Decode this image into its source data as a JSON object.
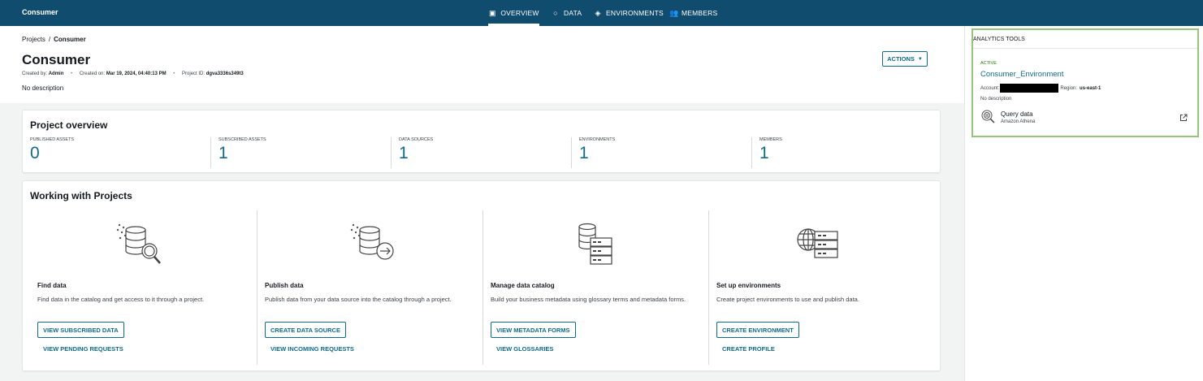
{
  "topbar": {
    "project_name": "Consumer",
    "tabs": [
      {
        "label": "OVERVIEW",
        "icon": "overview-icon",
        "active": true
      },
      {
        "label": "DATA",
        "icon": "data-circle-icon",
        "active": false
      },
      {
        "label": "ENVIRONMENTS",
        "icon": "layers-icon",
        "active": false
      },
      {
        "label": "MEMBERS",
        "icon": "members-icon",
        "active": false
      }
    ]
  },
  "header": {
    "breadcrumb": [
      "Projects",
      "Consumer"
    ],
    "breadcrumb_sep": "/",
    "title": "Consumer",
    "created_by_label": "Created by:",
    "created_by": "Admin",
    "created_on_label": "Created on:",
    "created_on": "Mar 19, 2024, 04:40:13 PM",
    "project_id_label": "Project ID:",
    "project_id": "dgva3336s349t3",
    "description": "No description",
    "actions_label": "ACTIONS"
  },
  "overview": {
    "title": "Project overview",
    "stats": [
      {
        "label": "PUBLISHED ASSETS",
        "value": "0"
      },
      {
        "label": "SUBSCRIBED ASSETS",
        "value": "1"
      },
      {
        "label": "DATA SOURCES",
        "value": "1"
      },
      {
        "label": "ENVIRONMENTS",
        "value": "1"
      },
      {
        "label": "MEMBERS",
        "value": "1"
      }
    ]
  },
  "working": {
    "title": "Working with Projects",
    "columns": [
      {
        "title": "Find data",
        "description": "Find data in the catalog and get access to it through a project.",
        "button": "VIEW SUBSCRIBED DATA",
        "link": "VIEW PENDING REQUESTS",
        "icon": "find-data-icon"
      },
      {
        "title": "Publish data",
        "description": "Publish data from your data source into the catalog through a project.",
        "button": "CREATE DATA SOURCE",
        "link": "VIEW INCOMING REQUESTS",
        "icon": "publish-data-icon"
      },
      {
        "title": "Manage data catalog",
        "description": "Build your business metadata using glossary terms and metadata forms.",
        "button": "VIEW METADATA FORMS",
        "link": "VIEW GLOSSARIES",
        "icon": "data-catalog-icon"
      },
      {
        "title": "Set up environments",
        "description": "Create project environments to use and publish data.",
        "button": "CREATE ENVIRONMENT",
        "link": "CREATE PROFILE",
        "icon": "environments-icon"
      }
    ]
  },
  "analytics": {
    "header": "ANALYTICS TOOLS",
    "status": "ACTIVE",
    "environment_name": "Consumer_Environment",
    "account_label": "Account:",
    "region_label": "Region:",
    "region": "us-east-1",
    "description": "No description",
    "tool_name": "Query data",
    "tool_sub": "Amazon Athena",
    "colors": {
      "highlight_border": "#94c57a",
      "active_status": "#1d8102"
    }
  },
  "colors": {
    "topbar": "#0f4c6e",
    "accent": "#0f6b8e"
  }
}
